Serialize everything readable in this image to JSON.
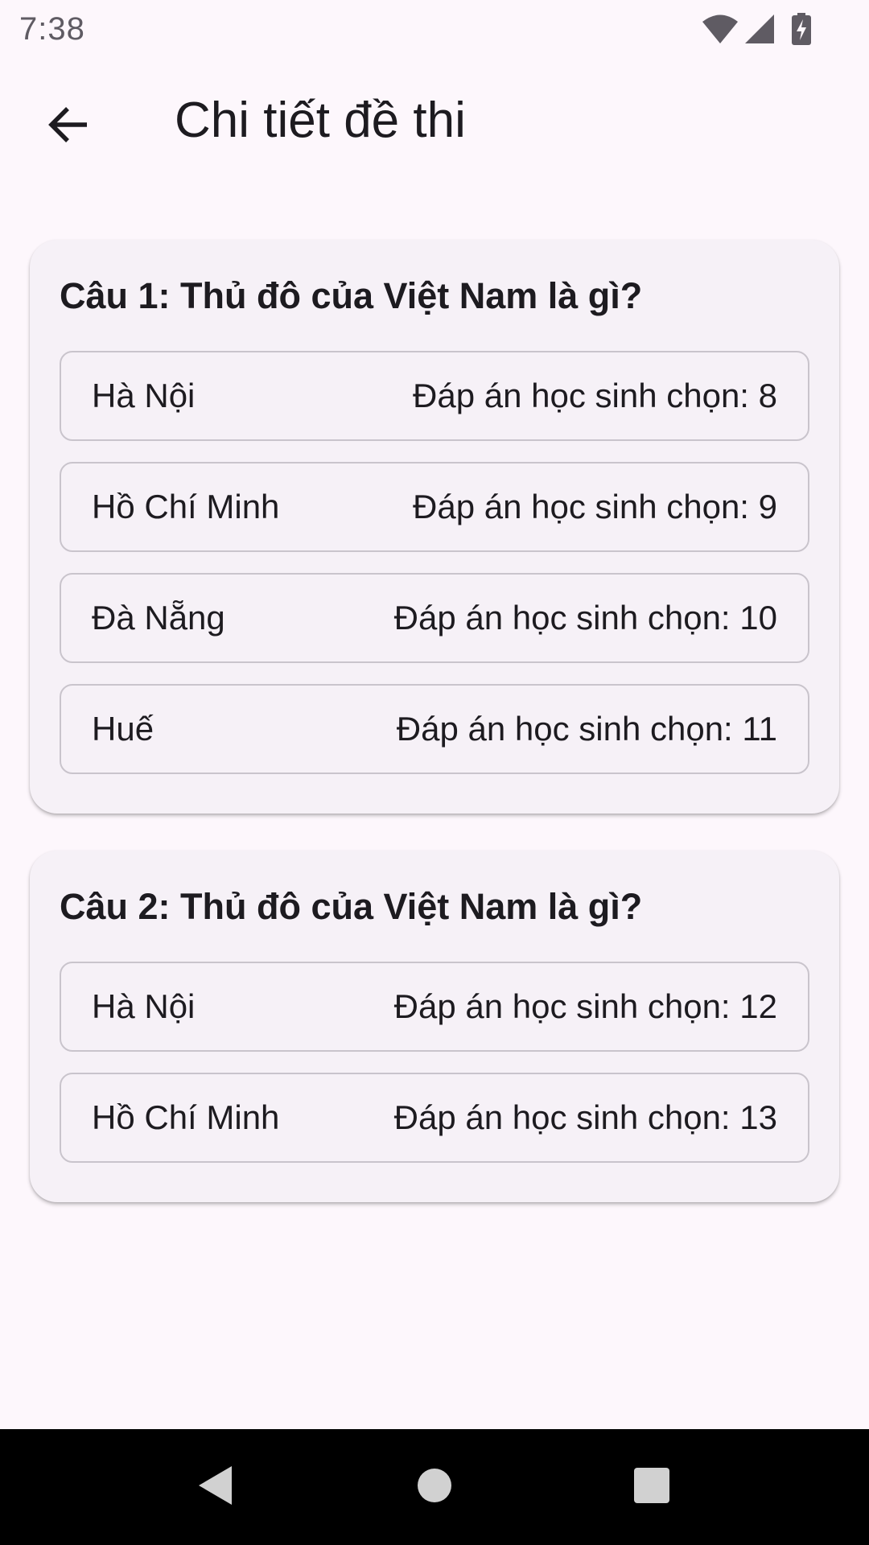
{
  "status_bar": {
    "time": "7:38",
    "icons": [
      "wifi-icon",
      "cell-signal-icon",
      "battery-charging-icon"
    ]
  },
  "app_bar": {
    "back_icon": "arrow-left-icon",
    "title": "Chi tiết đề thi"
  },
  "questions": [
    {
      "text": "Câu 1: Thủ đô của Việt Nam là gì?",
      "answers": [
        {
          "label": "Hà Nội",
          "count_text": "Đáp án học sinh chọn: 8"
        },
        {
          "label": "Hồ Chí Minh",
          "count_text": "Đáp án học sinh chọn: 9"
        },
        {
          "label": "Đà Nẵng",
          "count_text": "Đáp án học sinh chọn: 10"
        },
        {
          "label": "Huế",
          "count_text": "Đáp án học sinh chọn: 11"
        }
      ]
    },
    {
      "text": "Câu 2: Thủ đô của Việt Nam là gì?",
      "answers": [
        {
          "label": "Hà Nội",
          "count_text": "Đáp án học sinh chọn: 12"
        },
        {
          "label": "Hồ Chí Minh",
          "count_text": "Đáp án học sinh chọn: 13"
        }
      ]
    }
  ],
  "nav_bar": {
    "buttons": [
      "nav-back-icon",
      "nav-home-icon",
      "nav-recents-icon"
    ]
  },
  "colors": {
    "background": "#fdf7fc",
    "card": "#f6f1f7",
    "outline": "#c9c4cc",
    "text": "#1d1b20"
  }
}
